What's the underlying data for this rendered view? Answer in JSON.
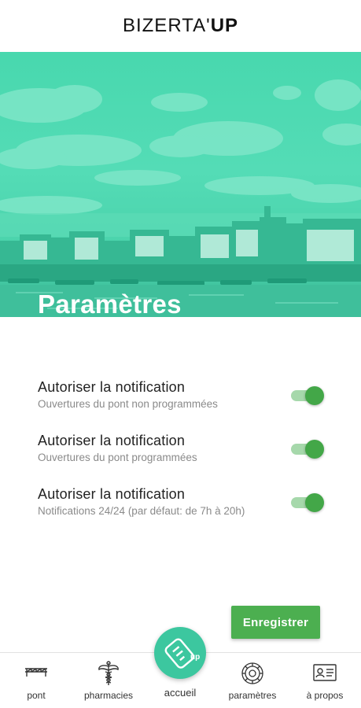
{
  "header": {
    "title_light": "BIZERTA'",
    "title_bold": "UP"
  },
  "hero": {
    "title": "Paramètres"
  },
  "settings": [
    {
      "title": "Autoriser la notification",
      "subtitle": "Ouvertures du pont non programmées",
      "enabled": true
    },
    {
      "title": "Autoriser la notification",
      "subtitle": "Ouvertures du pont programmées",
      "enabled": true
    },
    {
      "title": "Autoriser la notification",
      "subtitle": "Notifications 24/24 (par défaut: de 7h à 20h)",
      "enabled": true
    }
  ],
  "save_button": {
    "label": "Enregistrer"
  },
  "nav": {
    "items": [
      {
        "label": "pont",
        "icon": "bridge-icon"
      },
      {
        "label": "pharmacies",
        "icon": "caduceus-icon"
      },
      {
        "label": "accueil",
        "icon": "bizerta-up-logo-icon"
      },
      {
        "label": "paramètres",
        "icon": "settings-gear-icon"
      },
      {
        "label": "à propos",
        "icon": "id-card-icon"
      }
    ]
  },
  "colors": {
    "accent": "#4caf50",
    "hero": "#52dab4",
    "toggle_on": "#43a748"
  }
}
